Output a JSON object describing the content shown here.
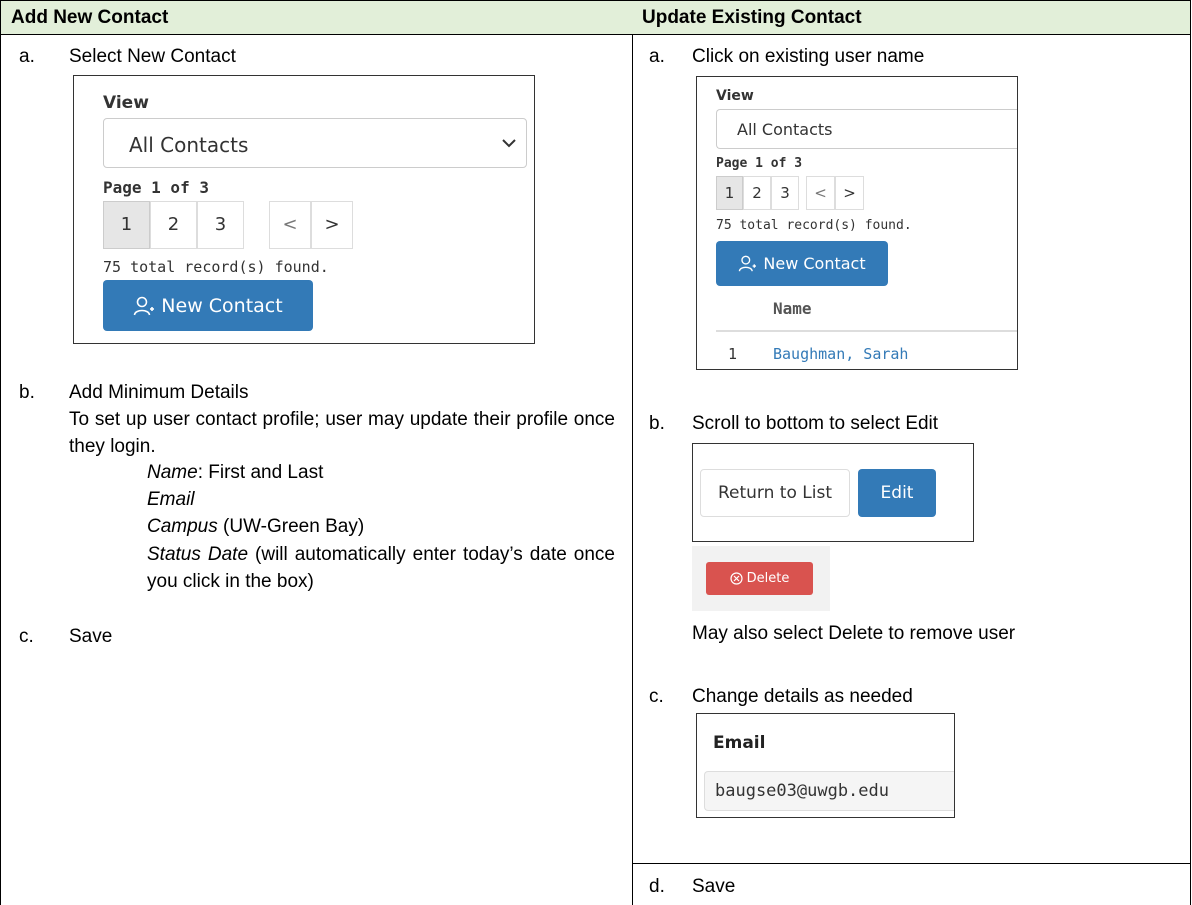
{
  "left": {
    "header": "Add New Contact",
    "steps": {
      "a": {
        "marker": "a.",
        "text": "Select New Contact"
      },
      "b": {
        "marker": "b.",
        "text": "Add Minimum Details",
        "description": "To set up user contact profile; user may update their profile once they login.",
        "fields": {
          "name_label": "Name",
          "name_rest": ":  First and Last",
          "email_label": "Email",
          "campus_label": "Campus",
          "campus_rest": " (UW-Green Bay)",
          "status_label": "Status Date",
          "status_rest": " (will automatically enter today’s date once you click in the box)"
        }
      },
      "c": {
        "marker": "c.",
        "text": "Save"
      }
    },
    "screenshot": {
      "view_label": "View",
      "view_value": "All Contacts",
      "page_label": "Page 1 of 3",
      "pages": [
        "1",
        "2",
        "3"
      ],
      "prev": "<",
      "next": ">",
      "records": "75 total record(s) found.",
      "new_contact": "New Contact"
    }
  },
  "right": {
    "header": "Update Existing Contact",
    "steps": {
      "a": {
        "marker": "a.",
        "text": "Click on existing user name"
      },
      "b": {
        "marker": "b.",
        "text": "Scroll to bottom to select Edit",
        "note": "May also select Delete to remove user"
      },
      "c": {
        "marker": "c.",
        "text": "Change details as needed"
      },
      "d": {
        "marker": "d.",
        "text": "Save"
      }
    },
    "screenshot_list": {
      "view_label": "View",
      "view_value": "All Contacts",
      "page_label": "Page 1 of 3",
      "pages": [
        "1",
        "2",
        "3"
      ],
      "prev": "<",
      "next": ">",
      "records": "75 total record(s) found.",
      "new_contact": "New Contact",
      "name_header": "Name",
      "row_number": "1",
      "row_name": "Baughman, Sarah"
    },
    "screenshot_edit": {
      "return_label": "Return to List",
      "edit_label": "Edit",
      "delete_label": "Delete"
    },
    "screenshot_email": {
      "label": "Email",
      "value": "baugse03@uwgb.edu"
    }
  },
  "colors": {
    "header_bg": "#e2efd9",
    "primary_blue": "#337ab7",
    "danger_red": "#d9534f"
  }
}
